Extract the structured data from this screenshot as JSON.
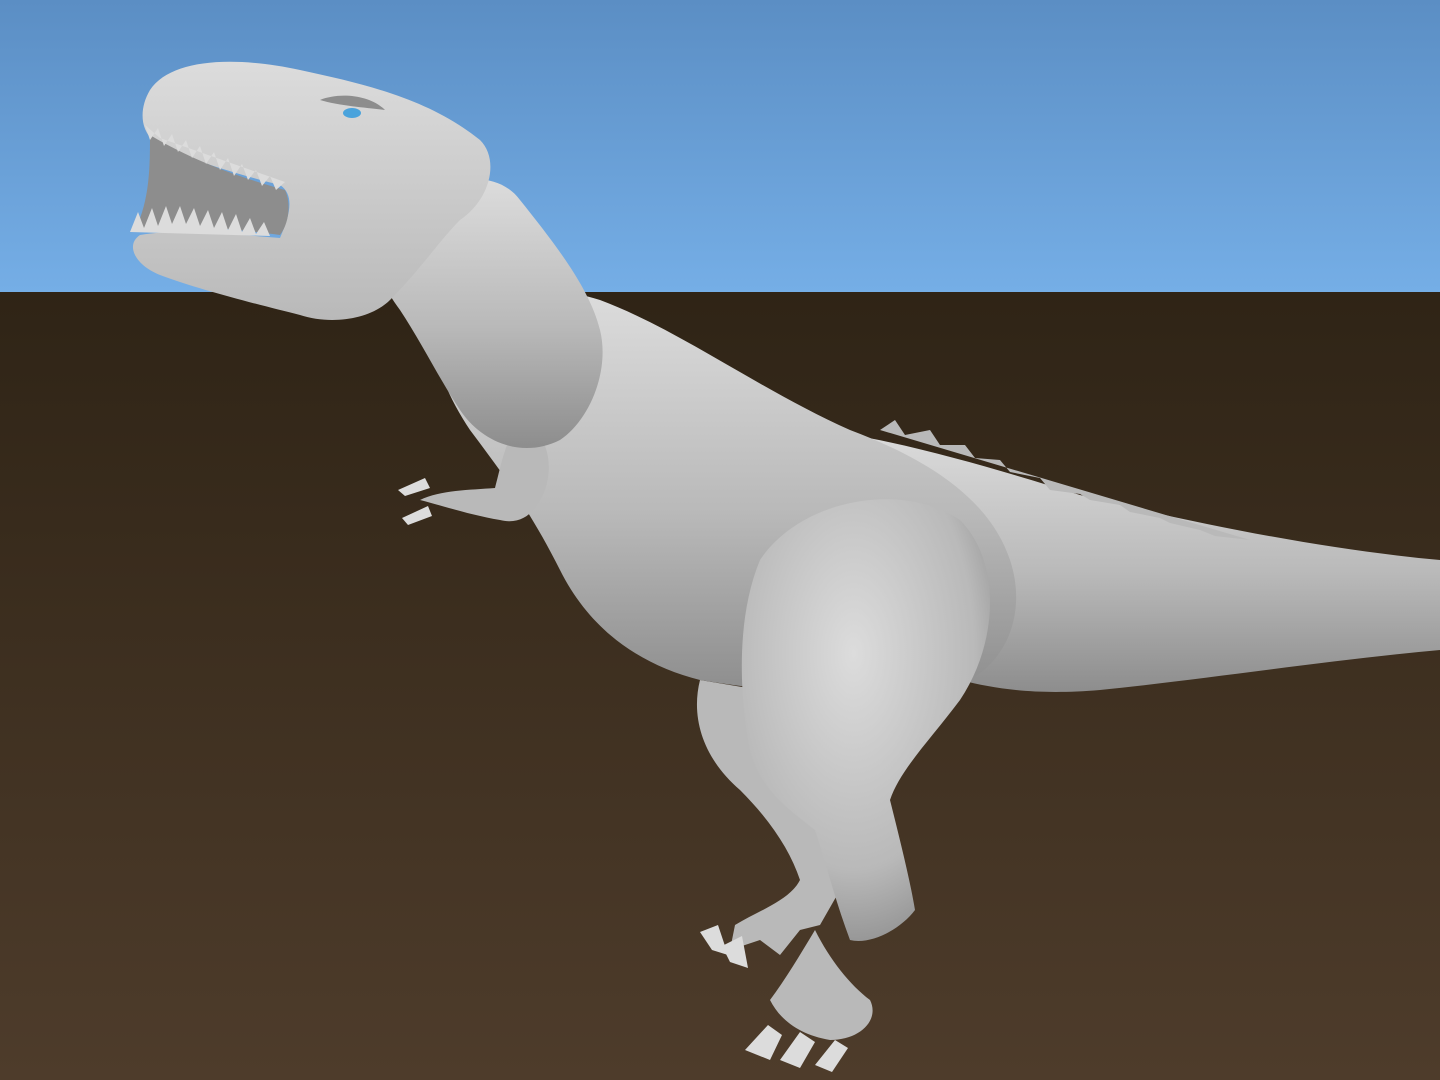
{
  "scene": {
    "subject": "t-rex-sculpt",
    "colors": {
      "sky_top": "#5b8ec4",
      "sky_bottom": "#75aee6",
      "ground_top": "#2f2416",
      "ground_bottom": "#4e3c2b",
      "model_light": "#dcdcdc",
      "model_mid": "#b9b9b9",
      "model_dark": "#8d8d8d",
      "eye": "#4aa3dc"
    }
  }
}
